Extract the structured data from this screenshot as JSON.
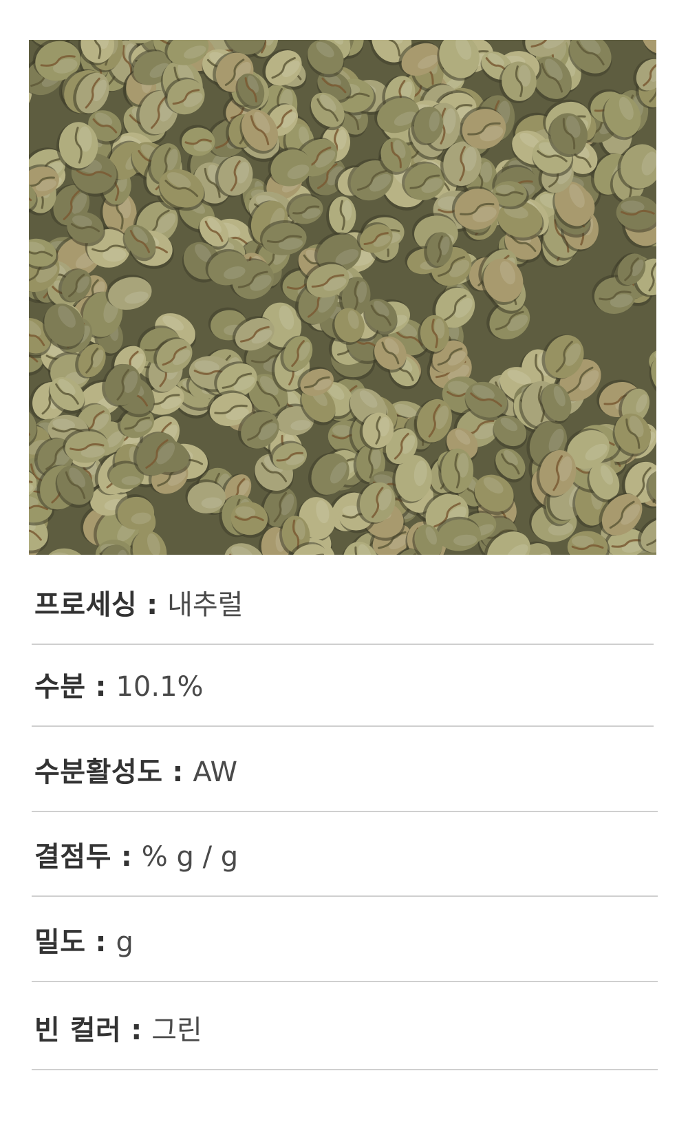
{
  "photo": {
    "subject": "green-coffee-beans"
  },
  "specs": {
    "sep": " : ",
    "items": [
      {
        "label": "프로세싱",
        "value": "내추럴"
      },
      {
        "label": "수분",
        "value": "10.1%"
      },
      {
        "label": "수분활성도",
        "value": "AW"
      },
      {
        "label": "결점두",
        "value": "% g / g"
      },
      {
        "label": "밀도",
        "value": "g"
      },
      {
        "label": "빈 컬러",
        "value": "그린"
      }
    ]
  },
  "colors": {
    "label": "#333333",
    "value": "#4a4a4a",
    "rule": "#cfcfcf",
    "bean": "#9a9868"
  }
}
